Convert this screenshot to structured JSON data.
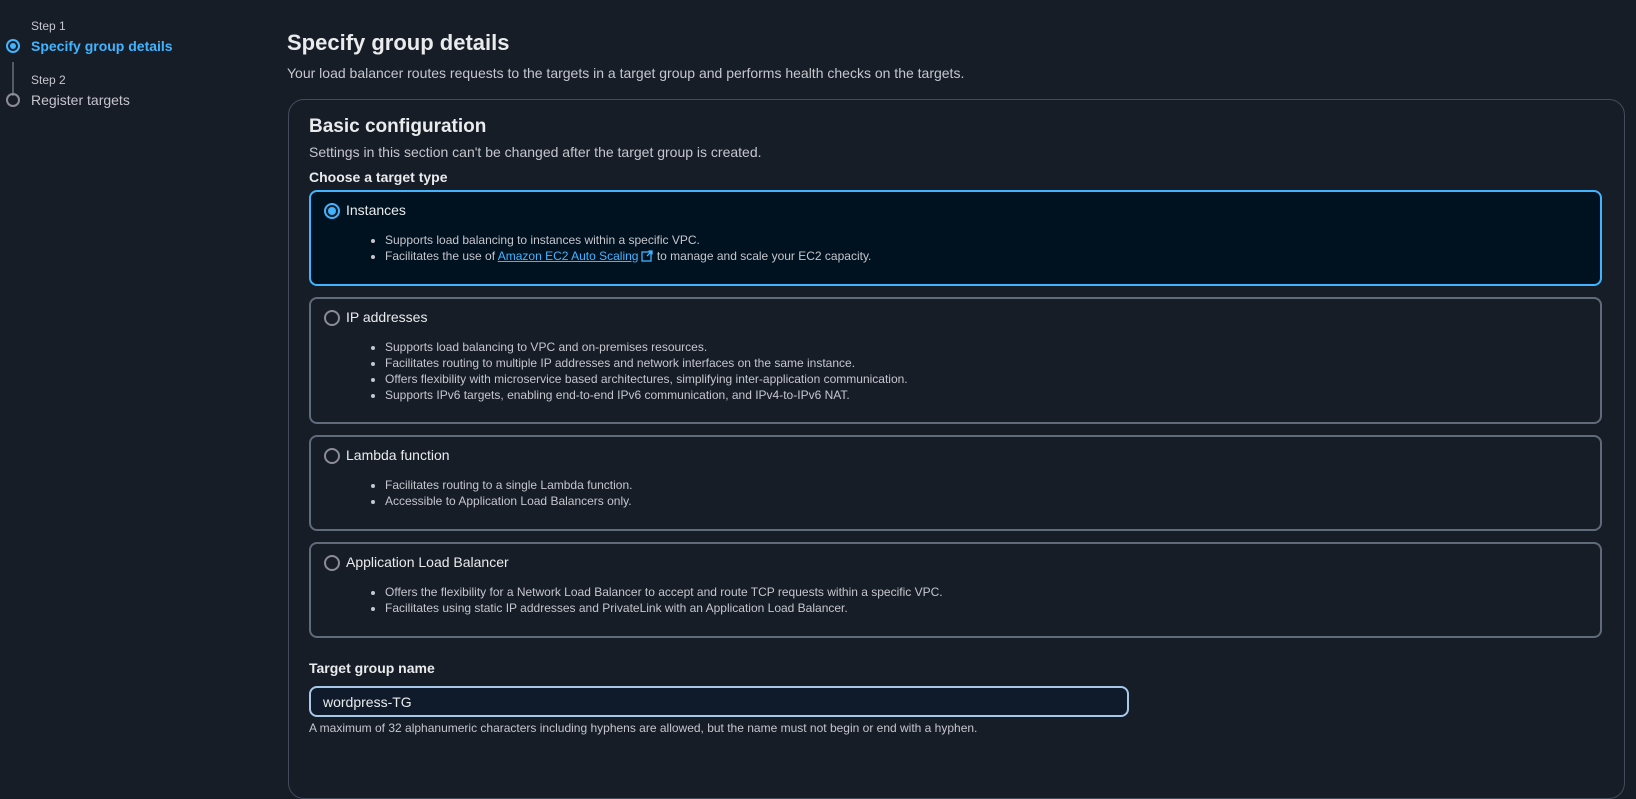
{
  "steps": [
    {
      "number": "Step 1",
      "title": "Specify group details",
      "state": "active"
    },
    {
      "number": "Step 2",
      "title": "Register targets",
      "state": "inactive"
    }
  ],
  "page": {
    "title": "Specify group details",
    "description": "Your load balancer routes requests to the targets in a target group and performs health checks on the targets."
  },
  "basic": {
    "title": "Basic configuration",
    "description": "Settings in this section can't be changed after the target group is created.",
    "target_type_label": "Choose a target type",
    "options": [
      {
        "title": "Instances",
        "selected": true,
        "bullets": [
          "Supports load balancing to instances within a specific VPC."
        ],
        "bullet_link": {
          "prefix": "Facilitates the use of ",
          "link": "Amazon EC2 Auto Scaling",
          "suffix": " to manage and scale your EC2 capacity."
        }
      },
      {
        "title": "IP addresses",
        "selected": false,
        "bullets": [
          "Supports load balancing to VPC and on-premises resources.",
          "Facilitates routing to multiple IP addresses and network interfaces on the same instance.",
          "Offers flexibility with microservice based architectures, simplifying inter-application communication.",
          "Supports IPv6 targets, enabling end-to-end IPv6 communication, and IPv4-to-IPv6 NAT."
        ]
      },
      {
        "title": "Lambda function",
        "selected": false,
        "bullets": [
          "Facilitates routing to a single Lambda function.",
          "Accessible to Application Load Balancers only."
        ]
      },
      {
        "title": "Application Load Balancer",
        "selected": false,
        "bullets": [
          "Offers the flexibility for a Network Load Balancer to accept and route TCP requests within a specific VPC.",
          "Facilitates using static IP addresses and PrivateLink with an Application Load Balancer."
        ]
      }
    ],
    "name_label": "Target group name",
    "name_value": "wordpress-TG",
    "name_help": "A maximum of 32 alphanumeric characters including hyphens are allowed, but the name must not begin or end with a hyphen."
  },
  "icons": {
    "external_link": "external-link-icon"
  },
  "colors": {
    "accent": "#42b4ff",
    "background": "#161d26",
    "selected_tile": "#00111f"
  }
}
